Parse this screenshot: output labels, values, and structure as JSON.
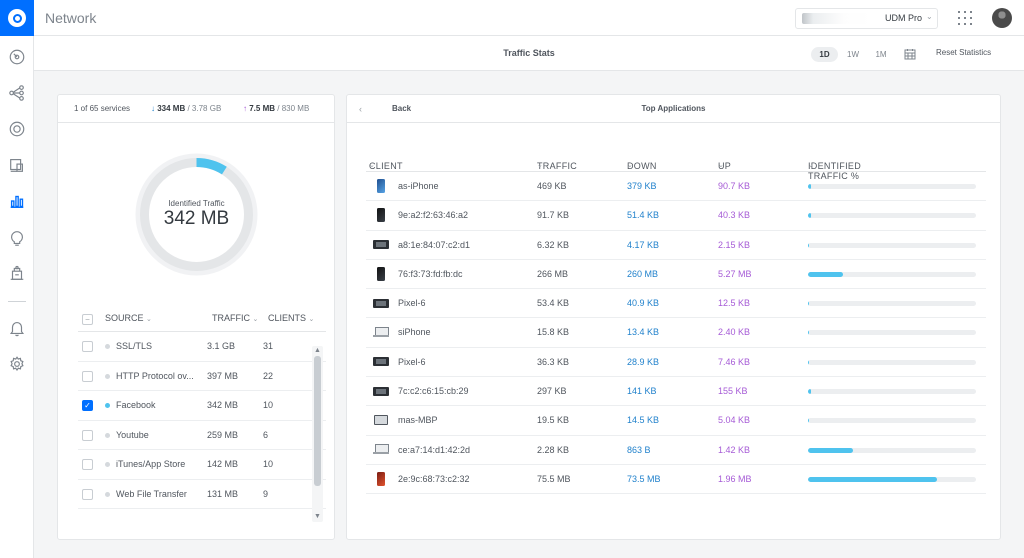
{
  "app": {
    "title": "Network"
  },
  "console": {
    "name": "UDM Pro"
  },
  "page": {
    "title": "Traffic Stats",
    "ranges": [
      {
        "label": "1D",
        "active": true
      },
      {
        "label": "1W",
        "active": false
      },
      {
        "label": "1M",
        "active": false
      }
    ],
    "reset_label": "Reset Statistics"
  },
  "sidebar": {
    "items": [
      "dashboard-icon",
      "topology-icon",
      "devices-icon",
      "clients-icon",
      "statistics-icon",
      "insights-icon",
      "events-icon",
      "alerts-icon",
      "settings-icon"
    ],
    "active": "statistics-icon"
  },
  "summary": {
    "services": "1 of 65 services",
    "download": "334 MB",
    "download_total": "/ 3.78 GB",
    "upload": "7.5 MB",
    "upload_total": "/ 830 MB",
    "identified_label": "Identified Traffic",
    "identified_value": "342 MB",
    "identified_fraction": 0.09
  },
  "sources": {
    "headers": {
      "source": "SOURCE",
      "traffic": "TRAFFIC",
      "clients": "CLIENTS"
    },
    "rows": [
      {
        "name": "SSL/TLS",
        "traffic": "3.1 GB",
        "clients": "31",
        "checked": false
      },
      {
        "name": "HTTP Protocol ov...",
        "traffic": "397 MB",
        "clients": "22",
        "checked": false
      },
      {
        "name": "Facebook",
        "traffic": "342 MB",
        "clients": "10",
        "checked": true
      },
      {
        "name": "Youtube",
        "traffic": "259 MB",
        "clients": "6",
        "checked": false
      },
      {
        "name": "iTunes/App Store",
        "traffic": "142 MB",
        "clients": "10",
        "checked": false
      },
      {
        "name": "Web File Transfer",
        "traffic": "131 MB",
        "clients": "9",
        "checked": false
      }
    ]
  },
  "top_apps": {
    "back_label": "Back",
    "title": "Top Applications",
    "headers": {
      "client": "CLIENT",
      "traffic": "TRAFFIC",
      "down": "DOWN",
      "up": "UP",
      "identified": "IDENTIFIED TRAFFIC %"
    },
    "rows": [
      {
        "device": "phone-blue",
        "name": "as-iPhone",
        "traffic": "469 KB",
        "down": "379 KB",
        "up": "90.7 KB",
        "pct": 0.015
      },
      {
        "device": "phone-dark",
        "name": "9e:a2:f2:63:46:a2",
        "traffic": "91.7 KB",
        "down": "51.4 KB",
        "up": "40.3 KB",
        "pct": 0.02
      },
      {
        "device": "pixel",
        "name": "a8:1e:84:07:c2:d1",
        "traffic": "6.32 KB",
        "down": "4.17 KB",
        "up": "2.15 KB",
        "pct": 0.0
      },
      {
        "device": "phone-dark",
        "name": "76:f3:73:fd:fb:dc",
        "traffic": "266 MB",
        "down": "260 MB",
        "up": "5.27 MB",
        "pct": 0.21
      },
      {
        "device": "pixel",
        "name": "Pixel-6",
        "traffic": "53.4 KB",
        "down": "40.9 KB",
        "up": "12.5 KB",
        "pct": 0.0
      },
      {
        "device": "laptop",
        "name": "siPhone",
        "traffic": "15.8 KB",
        "down": "13.4 KB",
        "up": "2.40 KB",
        "pct": 0.0
      },
      {
        "device": "pixel",
        "name": "Pixel-6",
        "traffic": "36.3 KB",
        "down": "28.9 KB",
        "up": "7.46 KB",
        "pct": 0.0
      },
      {
        "device": "pixel",
        "name": "7c:c2:c6:15:cb:29",
        "traffic": "297 KB",
        "down": "141 KB",
        "up": "155 KB",
        "pct": 0.005
      },
      {
        "device": "mbp",
        "name": "mas-MBP",
        "traffic": "19.5 KB",
        "down": "14.5 KB",
        "up": "5.04 KB",
        "pct": 0.0
      },
      {
        "device": "laptop",
        "name": "ce:a7:14:d1:42:2d",
        "traffic": "2.28 KB",
        "down": "863 B",
        "up": "1.42 KB",
        "pct": 0.27
      },
      {
        "device": "phone-red",
        "name": "2e:9c:68:73:c2:32",
        "traffic": "75.5 MB",
        "down": "73.5 MB",
        "up": "1.96 MB",
        "pct": 0.77
      }
    ]
  },
  "colors": {
    "accent": "#006fff",
    "down": "#2282cc",
    "up": "#a65bd6",
    "bar": "#4fc3ee"
  }
}
